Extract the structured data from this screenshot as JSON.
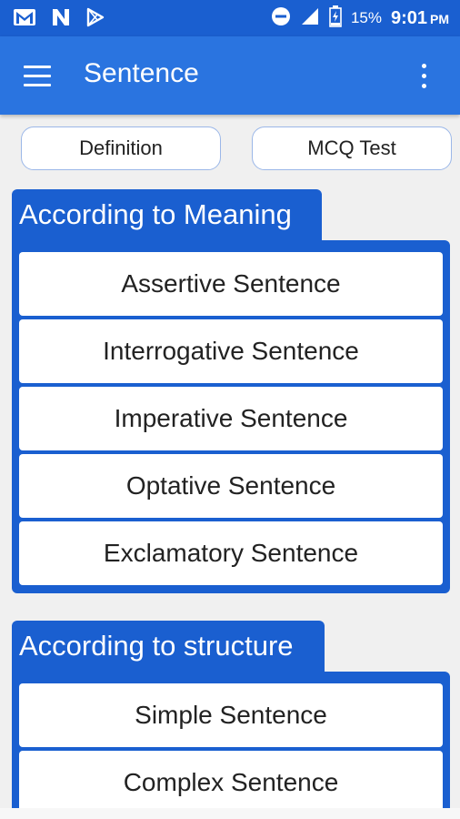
{
  "status_bar": {
    "battery": "15%",
    "time": "9:01",
    "ampm": "PM"
  },
  "app_bar": {
    "title": "Sentence"
  },
  "top_buttons": {
    "definition": "Definition",
    "mcq": "MCQ Test"
  },
  "sections": [
    {
      "title": "According to Meaning",
      "items": [
        "Assertive Sentence",
        "Interrogative Sentence",
        "Imperative Sentence",
        "Optative Sentence",
        "Exclamatory Sentence"
      ]
    },
    {
      "title": "According to structure",
      "items": [
        "Simple Sentence",
        "Complex Sentence"
      ]
    }
  ],
  "colors": {
    "status_bar": "#1a5fd0",
    "app_bar": "#2a74e0",
    "section": "#1a5fd0"
  }
}
